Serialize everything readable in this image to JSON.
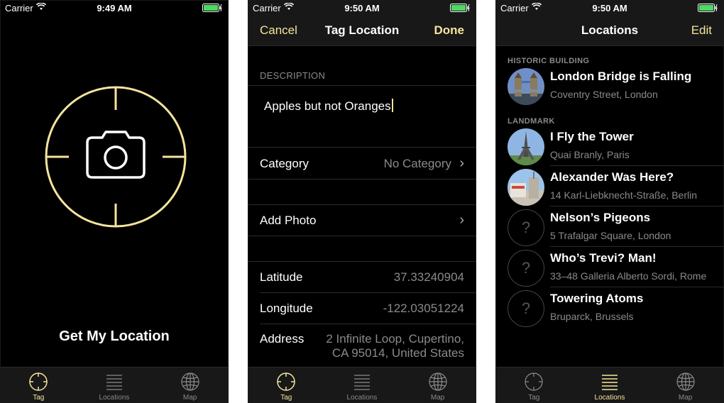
{
  "accent_color": "#f4e59d",
  "status": {
    "carrier": "Carrier",
    "times": [
      "9:49 AM",
      "9:50 AM",
      "9:50 AM"
    ]
  },
  "tabs": {
    "tag": "Tag",
    "locations": "Locations",
    "map": "Map"
  },
  "tag_screen": {
    "button_label": "Get My Location",
    "icons": [
      "crosshair-icon",
      "camera-icon"
    ]
  },
  "tag_location_screen": {
    "title": "Tag Location",
    "cancel_label": "Cancel",
    "done_label": "Done",
    "description_header": "DESCRIPTION",
    "description_value": "Apples but not Oranges",
    "category_label": "Category",
    "category_value": "No Category",
    "add_photo_label": "Add Photo",
    "latitude_label": "Latitude",
    "latitude_value": "37.33240904",
    "longitude_label": "Longitude",
    "longitude_value": "-122.03051224",
    "address_label": "Address",
    "address_line1": "2 Infinite Loop, Cupertino,",
    "address_line2": "CA 95014, United States"
  },
  "locations_screen": {
    "title": "Locations",
    "edit_label": "Edit",
    "groups": [
      {
        "header": "HISTORIC BUILDING",
        "items": [
          {
            "title": "London Bridge is Falling",
            "subtitle": "Coventry Street, London",
            "photo": "tower-bridge-photo"
          }
        ]
      },
      {
        "header": "LANDMARK",
        "items": [
          {
            "title": "I Fly the Tower",
            "subtitle": "Quai Branly, Paris",
            "photo": "eiffel-tower-photo"
          },
          {
            "title": "Alexander Was Here?",
            "subtitle": "14 Karl-Liebknecht-Straße, Berlin",
            "photo": "berlin-photo"
          },
          {
            "title": "Nelson’s Pigeons",
            "subtitle": "5 Trafalgar Square, London",
            "photo": "none"
          },
          {
            "title": "Who’s Trevi? Man!",
            "subtitle": "33–48 Galleria Alberto Sordi, Rome",
            "photo": "none"
          },
          {
            "title": "Towering Atoms",
            "subtitle": "Bruparck, Brussels",
            "photo": "none"
          }
        ]
      }
    ],
    "placeholder_glyph": "?"
  }
}
